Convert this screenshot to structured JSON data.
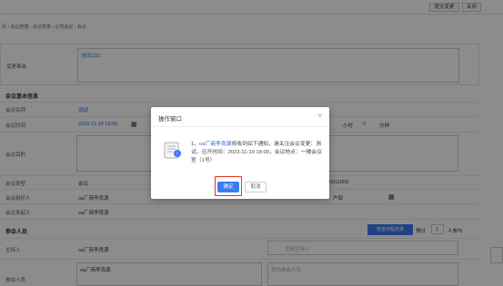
{
  "topbar": {
    "submit_change": "提交变更",
    "close": "关闭"
  },
  "breadcrumb": "页 › 会议管理 › 会议安排 › 公司会议 › 会议",
  "change_reason": {
    "label": "变更事由",
    "value": "测试1111"
  },
  "basic_info": {
    "title": "会议基本信息",
    "name_label": "会议名称",
    "name_value": "测试",
    "time_label": "会议时间",
    "time_value": "2023-11-19 18:00",
    "duration_hours_label": "小时",
    "duration_hours": "0",
    "duration_minutes_label": "分钟",
    "goal_label": "会议目的",
    "type_label": "会议类型",
    "type_value": "会议",
    "number_fragment": "0311003",
    "organizer_label": "会议组织人",
    "organizer_value": "oa厂商李良源",
    "dept_fragment": "户部",
    "initiator_label": "会议发起人",
    "initiator_value": "oa厂商李良源"
  },
  "participants": {
    "title": "参会人员",
    "check_schedule_button": "检查日程安排",
    "estimate_label": "预计",
    "estimate_value": "1",
    "estimate_unit": "人参与",
    "host_label": "主持人",
    "host_value": "oa厂商李良源",
    "other_host_placeholder": "其他主持人",
    "attendees_label": "参加人员",
    "attendees_value": "oa厂商李良源",
    "other_attendees_placeholder": "其他参会人员"
  },
  "modal": {
    "title": "操作窗口",
    "close_glyph": "×",
    "link_text": "oa厂商李良源",
    "message_prefix": "1、",
    "message_rest": "将收到如下通知，请关注会议变更：测试，召开时间：2023-11-19 18:00，会议地点：一楼会议室（1号）",
    "confirm": "确定",
    "cancel": "取消"
  },
  "colors": {
    "primary": "#3d7bf2",
    "highlight": "#e8321d",
    "link": "#2a6ad6"
  }
}
